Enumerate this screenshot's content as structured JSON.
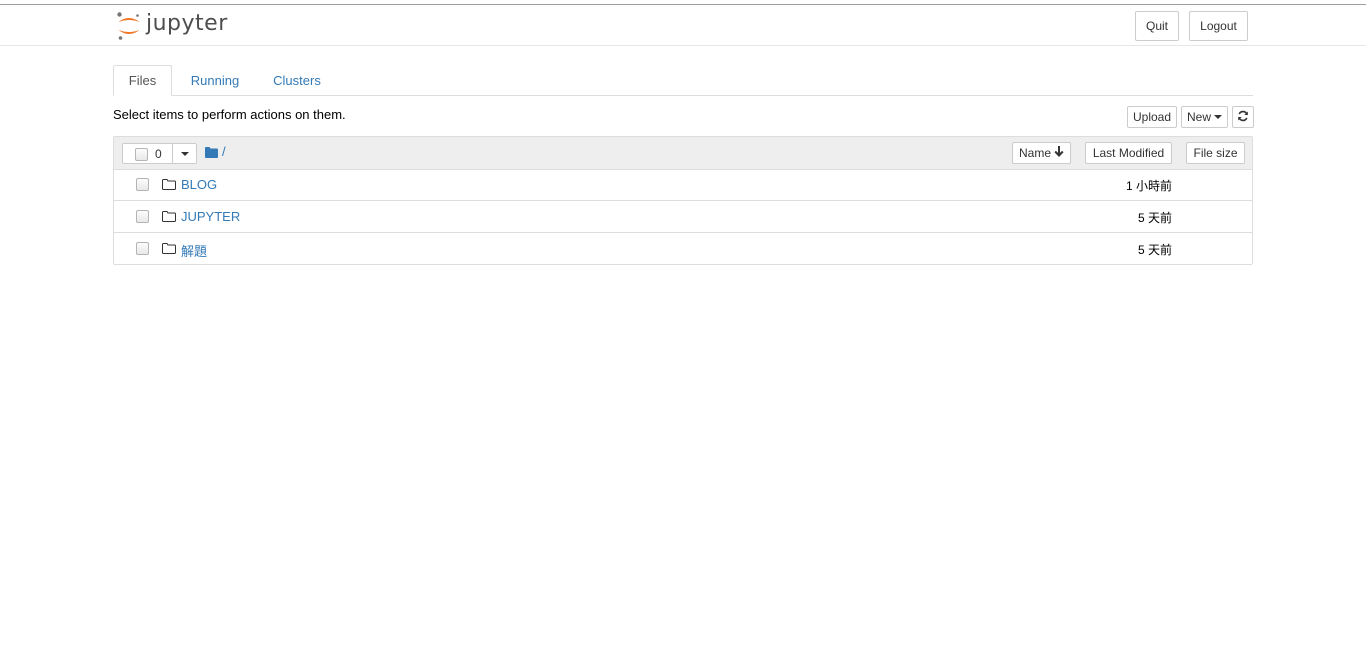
{
  "header": {
    "logo_text": "jupyter",
    "quit_label": "Quit",
    "logout_label": "Logout"
  },
  "tabs": [
    {
      "label": "Files",
      "active": true
    },
    {
      "label": "Running",
      "active": false
    },
    {
      "label": "Clusters",
      "active": false
    }
  ],
  "toolbar": {
    "hint": "Select items to perform actions on them.",
    "upload_label": "Upload",
    "new_label": "New",
    "refresh_icon": "refresh-icon"
  },
  "list_header": {
    "selected_count": "0",
    "breadcrumb_path": "/",
    "sort_name_label": "Name",
    "sort_modified_label": "Last Modified",
    "sort_size_label": "File size"
  },
  "items": [
    {
      "name": "BLOG",
      "modified": "1 小時前",
      "type": "folder"
    },
    {
      "name": "JUPYTER",
      "modified": "5 天前",
      "type": "folder"
    },
    {
      "name": "解題",
      "modified": "5 天前",
      "type": "folder"
    }
  ],
  "colors": {
    "link": "#337ab7",
    "logo_orange": "#f37726",
    "header_bg": "#eeeeee"
  }
}
